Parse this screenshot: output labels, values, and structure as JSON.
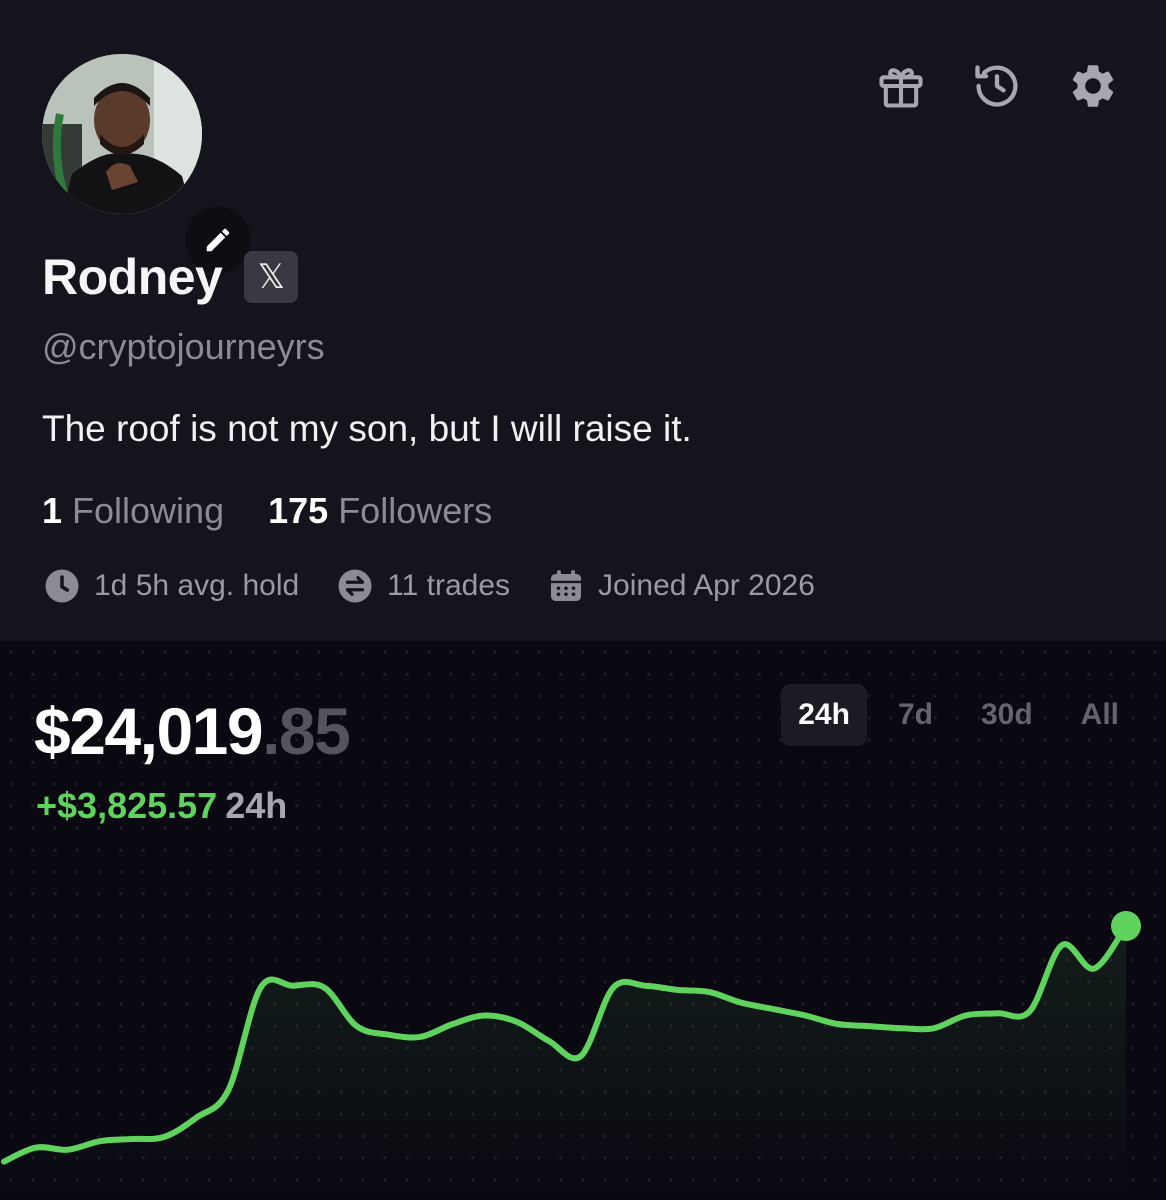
{
  "profile": {
    "name": "Rodney",
    "x_badge": "𝕏",
    "handle": "@cryptojourneyrs",
    "bio": "The roof is not my son, but I will raise it.",
    "following_count": "1",
    "following_label": "Following",
    "followers_count": "175",
    "followers_label": "Followers",
    "avg_hold": "1d 5h avg. hold",
    "trades": "11 trades",
    "joined": "Joined Apr 2026"
  },
  "header_icons": [
    "gift-icon",
    "history-icon",
    "gear-icon"
  ],
  "portfolio": {
    "balance_main": "$24,019",
    "balance_cents": ".85",
    "change_amount": "+$3,825.57",
    "change_period": "24h",
    "ranges": [
      {
        "label": "24h",
        "active": true
      },
      {
        "label": "7d",
        "active": false
      },
      {
        "label": "30d",
        "active": false
      },
      {
        "label": "All",
        "active": false
      }
    ]
  },
  "colors": {
    "accent_green": "#5fd35e",
    "background": "#0a0912",
    "profile_background": "#15131c"
  },
  "chart_data": {
    "type": "line",
    "range": "24h",
    "grid": true,
    "y": [
      20194.28,
      20260,
      20250,
      20290,
      20300,
      20310,
      20400,
      20530,
      21010,
      21020,
      21010,
      20830,
      20790,
      20780,
      20840,
      20880,
      20850,
      20760,
      20690,
      21010,
      21020,
      21000,
      20990,
      20940,
      20910,
      20880,
      20840,
      20830,
      20820,
      20820,
      20880,
      20890,
      20900,
      21210,
      21100,
      24019.85
    ]
  }
}
